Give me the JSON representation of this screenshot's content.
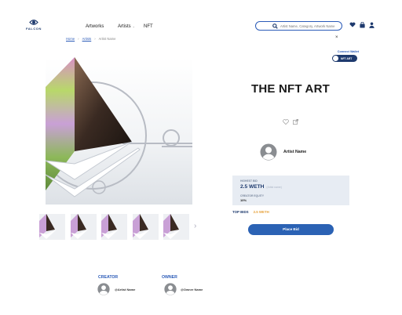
{
  "header": {
    "logo_text": "FALCON",
    "nav": {
      "artworks": "Artworks",
      "artists": "Artists",
      "nft": "NFT"
    },
    "search_placeholder": "Artist Name, Category, Artwork Name"
  },
  "breadcrumb": [
    "Home",
    "Artists",
    "Artist Name"
  ],
  "close_label": "×",
  "wallet": {
    "connect_label": "Connect Wallet",
    "toggle_label": "NFT ART"
  },
  "artwork": {
    "title": "THE NFT ART",
    "artist_name": "Artist Name",
    "thumbnail_count": 5,
    "next_label": "›"
  },
  "bid": {
    "highest_bid_label": "HIGHEST BID",
    "highest_bid_value": "2.5 WETH",
    "highest_bid_sub": "(Artist name)",
    "creator_equity_label": "CREATOR EQUITY",
    "creator_equity_value": "10%",
    "top_bids_label": "TOP BIDS",
    "top_bids_value": "2.5 WETH",
    "place_bid_label": "Place Bid"
  },
  "people": {
    "creator_label": "CREATOR",
    "creator_name": "@Artist Name",
    "owner_label": "OWNER",
    "owner_name": "@Owner Name"
  },
  "colors": {
    "accent": "#2b5bb8",
    "navy": "#1e3a6e",
    "bid_box": "#e7ecf3",
    "orange": "#e6a23c",
    "button": "#2b62b4"
  }
}
